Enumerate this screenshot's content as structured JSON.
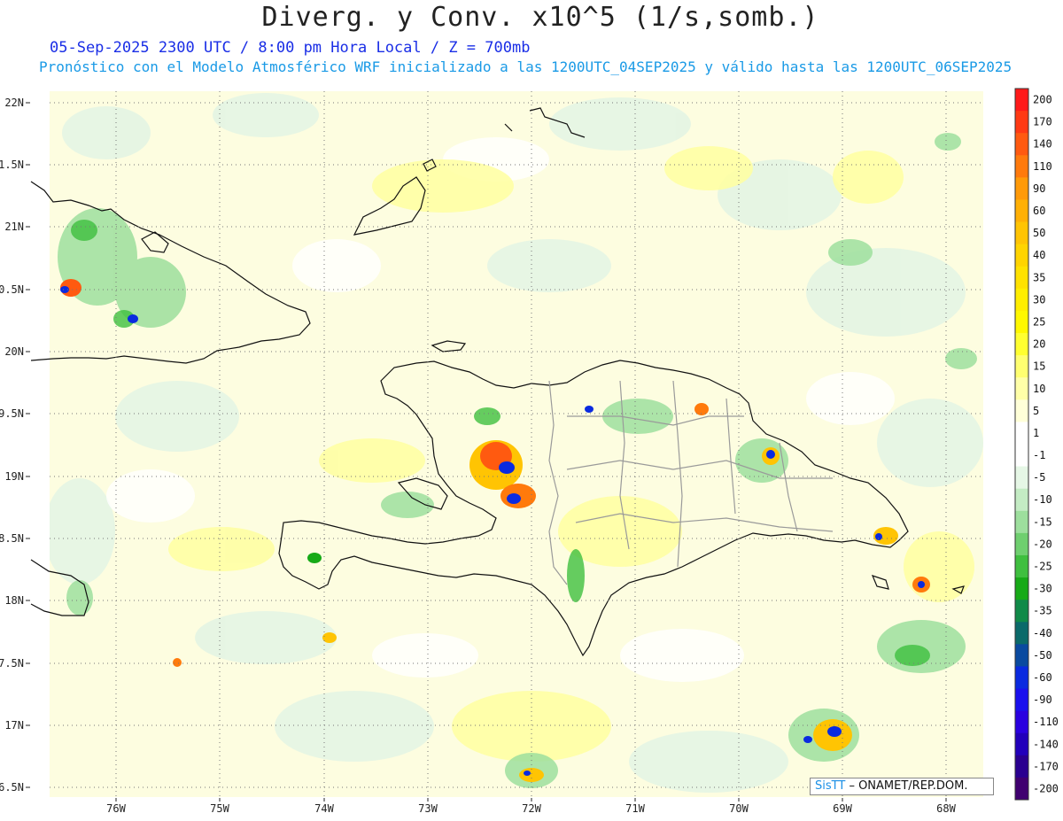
{
  "header": {
    "title": "Diverg. y Conv. x10^5 (1/s,somb.)",
    "subtitle": "05-Sep-2025  2300 UTC / 8:00 pm Hora Local / Z = 700mb",
    "model_line": "Pronóstico con el Modelo Atmosférico WRF inicializado a las 1200UTC_04SEP2025 y válido hasta las  1200UTC_06SEP2025"
  },
  "map": {
    "lat_labels": [
      "22N",
      "1.5N",
      "21N",
      "0.5N",
      "20N",
      "9.5N",
      "19N",
      "8.5N",
      "18N",
      "7.5N",
      "17N",
      "6.5N"
    ],
    "lon_labels": [
      "76W",
      "75W",
      "74W",
      "73W",
      "72W",
      "71W",
      "70W",
      "69W",
      "68W"
    ],
    "background_color": "#fdfde0"
  },
  "colorbar": {
    "labels": [
      "200",
      "170",
      "140",
      "110",
      "90",
      "60",
      "50",
      "40",
      "35",
      "30",
      "25",
      "20",
      "15",
      "10",
      "5",
      "1",
      "-1",
      "-5",
      "-10",
      "-15",
      "-20",
      "-25",
      "-30",
      "-35",
      "-40",
      "-50",
      "-60",
      "-90",
      "-110",
      "-140",
      "-170",
      "-200"
    ],
    "colors": [
      "#ff1a1a",
      "#ff3a14",
      "#ff5a10",
      "#ff7a0c",
      "#ff9a08",
      "#ffb005",
      "#ffc403",
      "#ffd400",
      "#ffe200",
      "#ffee00",
      "#fff800",
      "#ffff30",
      "#ffff70",
      "#ffffa8",
      "#ffffd8",
      "#ffffff",
      "#ffffff",
      "#e6f7e6",
      "#c4ecc4",
      "#9ddf9d",
      "#6fcf6f",
      "#3fbf3f",
      "#17aa17",
      "#108a48",
      "#0b6a6a",
      "#0a4aa0",
      "#0a2ae0",
      "#1a10ee",
      "#2a00e0",
      "#2200bb",
      "#2a0090",
      "#400070"
    ]
  },
  "credit": {
    "logo": "SisTT",
    "text": "– ONAMET/REP.DOM."
  }
}
